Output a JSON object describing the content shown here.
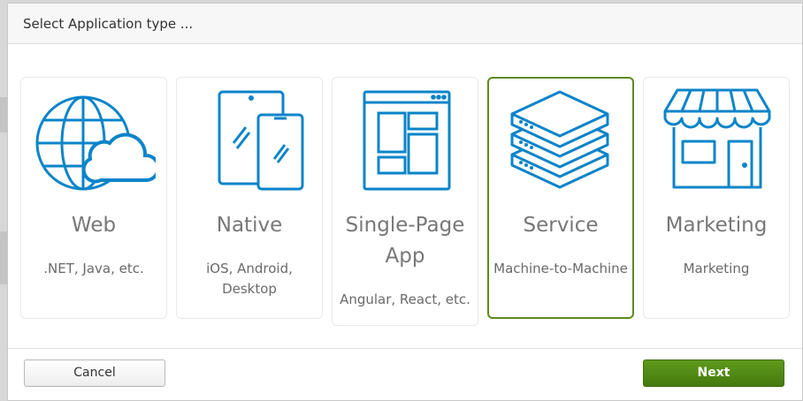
{
  "dialog": {
    "title": "Select Application type ...",
    "cancel_label": "Cancel",
    "next_label": "Next"
  },
  "cards": [
    {
      "title": "Web",
      "description": ".NET, Java, etc.",
      "icon": "globe-cloud-icon",
      "selected": false
    },
    {
      "title": "Native",
      "description": "iOS, Android, Desktop",
      "icon": "tablet-phone-icon",
      "selected": false
    },
    {
      "title": "Single-Page App",
      "description": "Angular, React, etc.",
      "icon": "browser-layout-icon",
      "selected": false
    },
    {
      "title": "Service",
      "description": "Machine-to-Machine",
      "icon": "server-stack-icon",
      "selected": true
    },
    {
      "title": "Marketing",
      "description": "Marketing",
      "icon": "storefront-icon",
      "selected": false
    }
  ],
  "colors": {
    "icon": "#0a84c9",
    "selected_border": "#5e8a23",
    "next_button": "#4f8a14"
  }
}
